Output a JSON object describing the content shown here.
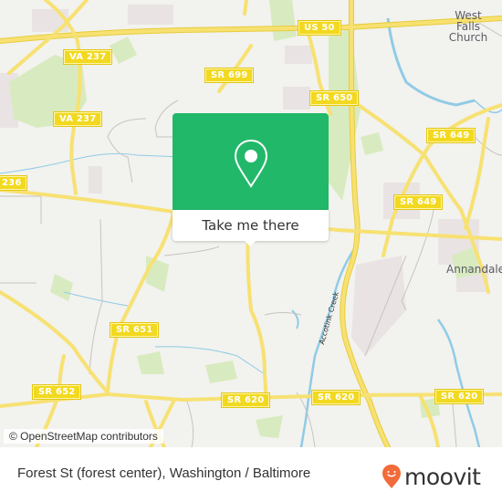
{
  "map": {
    "attribution": "© OpenStreetMap contributors",
    "road_labels": [
      {
        "id": "us50",
        "text": "US 50"
      },
      {
        "id": "va237a",
        "text": "VA 237"
      },
      {
        "id": "va237b",
        "text": "VA 237"
      },
      {
        "id": "sr699",
        "text": "SR 699"
      },
      {
        "id": "sr650",
        "text": "SR 650"
      },
      {
        "id": "sr649a",
        "text": "SR 649"
      },
      {
        "id": "sr649b",
        "text": "SR 649"
      },
      {
        "id": "va236",
        "text": "236"
      },
      {
        "id": "sr651",
        "text": "SR 651"
      },
      {
        "id": "sr652",
        "text": "SR 652"
      },
      {
        "id": "sr620a",
        "text": "SR 620"
      },
      {
        "id": "sr620b",
        "text": "SR 620"
      },
      {
        "id": "sr620c",
        "text": "SR 620"
      }
    ],
    "place_labels": {
      "west_falls_church": [
        "West",
        "Falls",
        "Church"
      ],
      "annandale": "Annandale"
    },
    "waterway_label": "Accotink Creek",
    "colors": {
      "land": "#f2f2ee",
      "road": "#f5dd5a",
      "park": "#d4eab8",
      "water": "#8cc8e8",
      "urban": "#e8e2e2"
    }
  },
  "popup": {
    "button_label": "Take me there",
    "icon": "map-pin-icon",
    "color": "#22b86a"
  },
  "footer": {
    "title": "Forest St (forest center), Washington / Baltimore",
    "brand": "moovit",
    "brand_color": "#f26b3a"
  }
}
